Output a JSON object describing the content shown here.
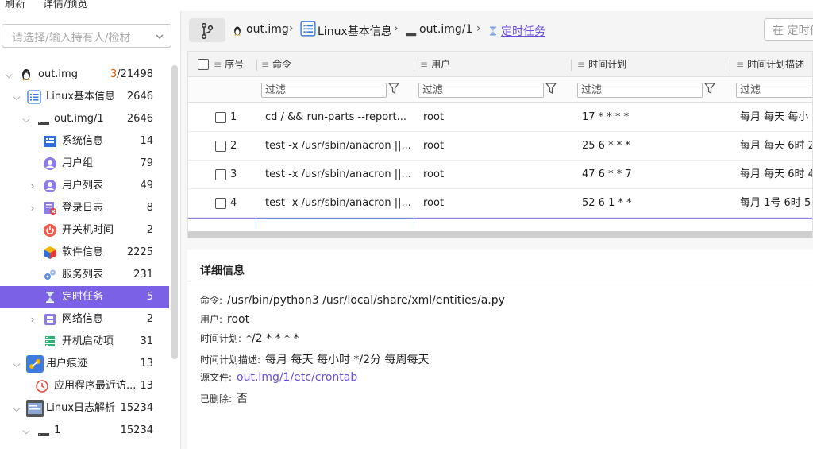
{
  "topbar": {
    "refresh_label": "刷新",
    "preview_label": "详情/预览"
  },
  "sidebar": {
    "selector_placeholder": "请选择/输入持有人/检材",
    "tree": [
      {
        "label": "out.img",
        "count_hl": "3",
        "count": "/21498",
        "icon": "linux-tux-icon",
        "level": 0,
        "arrow": "expanded"
      },
      {
        "label": "Linux基本信息",
        "count": "2646",
        "icon": "list-icon",
        "level": 1,
        "arrow": "expanded"
      },
      {
        "label": "out.img/1",
        "count": "2646",
        "icon": "disk-icon",
        "level": 2,
        "arrow": "expanded"
      },
      {
        "label": "系统信息",
        "count": "14",
        "icon": "system-info-icon",
        "level": 3,
        "arrow": "none"
      },
      {
        "label": "用户组",
        "count": "79",
        "icon": "user-group-icon",
        "level": 3,
        "arrow": "none"
      },
      {
        "label": "用户列表",
        "count": "49",
        "icon": "user-list-icon",
        "level": 3,
        "arrow": "collapsed"
      },
      {
        "label": "登录日志",
        "count": "8",
        "icon": "login-log-icon",
        "level": 3,
        "arrow": "collapsed"
      },
      {
        "label": "开关机时间",
        "count": "2",
        "icon": "power-icon",
        "level": 3,
        "arrow": "none"
      },
      {
        "label": "软件信息",
        "count": "2225",
        "icon": "software-box-icon",
        "level": 3,
        "arrow": "none"
      },
      {
        "label": "服务列表",
        "count": "231",
        "icon": "service-icon",
        "level": 3,
        "arrow": "none"
      },
      {
        "label": "定时任务",
        "count": "5",
        "icon": "hourglass-icon",
        "level": 3,
        "arrow": "none",
        "selected": true
      },
      {
        "label": "网络信息",
        "count": "2",
        "icon": "network-icon",
        "level": 3,
        "arrow": "collapsed"
      },
      {
        "label": "开机启动项",
        "count": "31",
        "icon": "startup-icon",
        "level": 3,
        "arrow": "none"
      },
      {
        "label": "用户痕迹",
        "count": "13",
        "icon": "user-trace-icon",
        "level": 1,
        "arrow": "expanded"
      },
      {
        "label": "应用程序最近访...",
        "count": "13",
        "icon": "recent-apps-icon",
        "level": 2,
        "arrow": "none"
      },
      {
        "label": "Linux日志解析",
        "count": "15234",
        "icon": "log-parse-icon",
        "level": 1,
        "arrow": "expanded"
      },
      {
        "label": "1",
        "count": "15234",
        "icon": "disk-icon",
        "level": 2,
        "arrow": "expanded"
      }
    ]
  },
  "breadcrumb": {
    "items": [
      "out.img",
      "Linux基本信息",
      "out.img/1",
      "定时任务"
    ],
    "search_placeholder": "在 定时任务"
  },
  "grid": {
    "columns": {
      "seq": "序号",
      "command": "命令",
      "user": "用户",
      "schedule": "时间计划",
      "schedule_desc": "时间计划描述"
    },
    "filter_placeholder": "过滤",
    "rows": [
      {
        "seq": "1",
        "command": "cd / && run-parts --report...",
        "user": "root",
        "schedule": "17 * * * *",
        "desc": "每月 每天 每小"
      },
      {
        "seq": "2",
        "command": "test -x /usr/sbin/anacron ||...",
        "user": "root",
        "schedule": "25 6 * * *",
        "desc": "每月 每天 6时 2"
      },
      {
        "seq": "3",
        "command": "test -x /usr/sbin/anacron ||...",
        "user": "root",
        "schedule": "47 6 * * 7",
        "desc": "每月 每天 6时 4"
      },
      {
        "seq": "4",
        "command": "test -x /usr/sbin/anacron ||...",
        "user": "root",
        "schedule": "52 6 1 * *",
        "desc": "每月 1号 6时 5"
      }
    ]
  },
  "detail": {
    "title": "详细信息",
    "fields": [
      {
        "label": "命令:",
        "value": "/usr/bin/python3 /usr/local/share/xml/entities/a.py"
      },
      {
        "label": "用户:",
        "value": "root"
      },
      {
        "label": "时间计划:",
        "value": "*/2 * * * *"
      },
      {
        "label": "时间计划描述:",
        "value": "每月 每天 每小时 */2分 每周每天"
      },
      {
        "label": "源文件:",
        "value": "out.img/1/etc/crontab",
        "link": true
      },
      {
        "label": "已删除:",
        "value": "否"
      }
    ]
  },
  "colors": {
    "accent": "#7b61e6",
    "link": "#6b4fd8"
  }
}
